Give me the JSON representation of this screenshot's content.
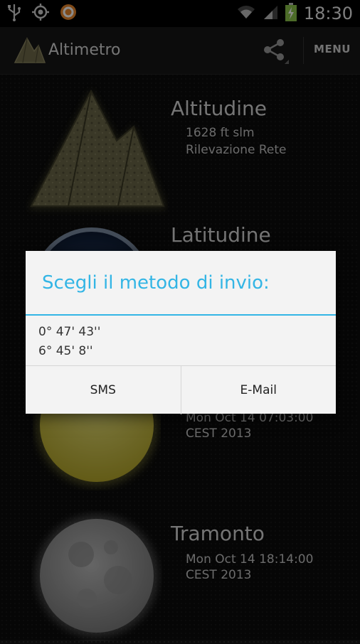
{
  "status_bar": {
    "time": "18:30",
    "left_icons": [
      "usb-icon",
      "gps-icon",
      "app-notification-icon"
    ],
    "right_icons": [
      "wifi-icon",
      "signal-icon",
      "battery-charging-icon"
    ]
  },
  "action_bar": {
    "title": "Altimetro",
    "menu_label": "MENU"
  },
  "rows": [
    {
      "title": "Altitudine",
      "lines": [
        "1628 ft slm",
        "Rilevazione Rete"
      ]
    },
    {
      "title": "Latitudine",
      "lines": []
    },
    {
      "title": "",
      "lines": [
        "Mon Oct 14 07:03:00",
        "CEST 2013"
      ]
    },
    {
      "title": "Tramonto",
      "lines": [
        "Mon Oct 14 18:14:00",
        "CEST 2013"
      ]
    }
  ],
  "dialog": {
    "title": "Scegli il metodo di invio:",
    "lines": [
      "0° 47' 43''",
      "6° 45' 8''"
    ],
    "buttons": [
      "SMS",
      "E-Mail"
    ]
  },
  "colors": {
    "accent": "#33b5e5",
    "dialog_bg": "#f3f3f3",
    "status_bar": "#000000",
    "action_bar": "#161616"
  }
}
